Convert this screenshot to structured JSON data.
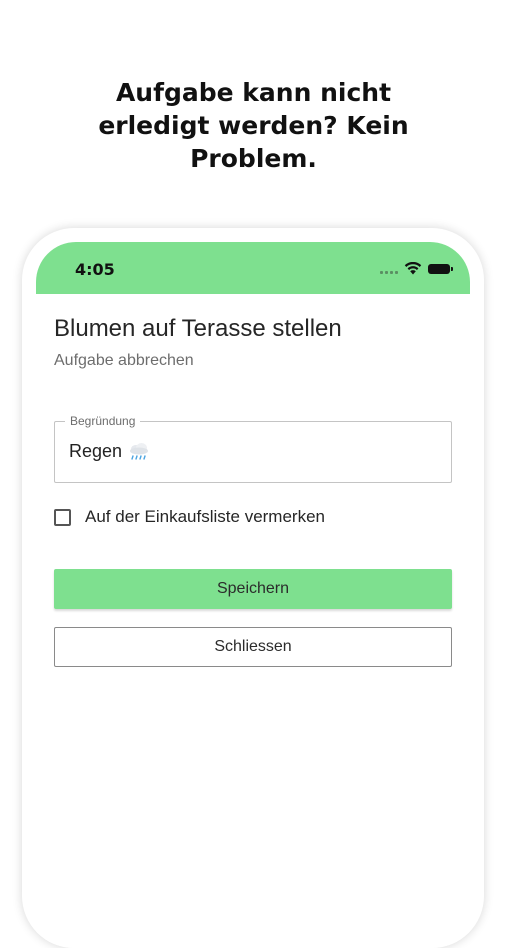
{
  "headline": {
    "line1": "Aufgabe kann nicht",
    "line2": "erledigt werden? Kein",
    "line3": "Problem."
  },
  "status_bar": {
    "time": "4:05",
    "icons": [
      "signal-icon",
      "wifi-icon",
      "battery-icon"
    ],
    "color": "#7ee08f"
  },
  "task": {
    "title": "Blumen auf Terasse stellen",
    "subtitle": "Aufgabe abbrechen"
  },
  "reason_field": {
    "label": "Begründung",
    "value": "Regen",
    "icon": "rain-cloud-icon"
  },
  "shopping_list_checkbox": {
    "label": "Auf der Einkaufsliste vermerken",
    "checked": false
  },
  "buttons": {
    "save_label": "Speichern",
    "close_label": "Schliessen"
  },
  "colors": {
    "accent": "#7ee08f"
  }
}
